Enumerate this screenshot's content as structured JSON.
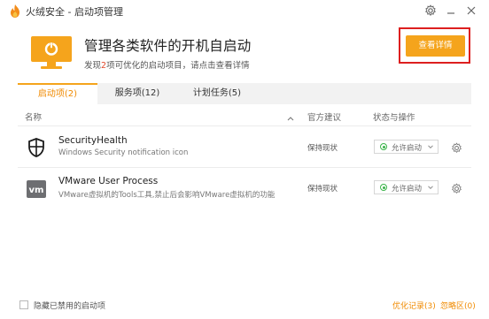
{
  "window": {
    "title": "火绒安全 - 启动项管理"
  },
  "header": {
    "heading": "管理各类软件的开机自启动",
    "subtitle_pre": "发现",
    "subtitle_count": "2",
    "subtitle_post": "项可优化的启动项目，请点击查看详情",
    "detail_button": "查看详情"
  },
  "tabs": [
    {
      "label": "启动项(2)",
      "active": true
    },
    {
      "label": "服务项(12)",
      "active": false
    },
    {
      "label": "计划任务(5)",
      "active": false
    }
  ],
  "table": {
    "col_name": "名称",
    "col_advice": "官方建议",
    "col_status": "状态与操作",
    "rows": [
      {
        "name": "SecurityHealth",
        "desc": "Windows Security notification icon",
        "advice": "保持现状",
        "status": "允许启动",
        "icon": "shield-icon"
      },
      {
        "name": "VMware User Process",
        "desc": "VMware虚拟机的Tools工具,禁止后会影响VMware虚拟机的功能",
        "advice": "保持现状",
        "status": "允许启动",
        "icon": "vmware-icon"
      }
    ]
  },
  "footer": {
    "hide_disabled": "隐藏已禁用的启动项",
    "optimize_log": "优化记录(3)",
    "ignore_zone": "忽略区(0)"
  },
  "colors": {
    "accent": "#f5a41c",
    "active_tab": "#f08a00",
    "highlight": "#dd1f1f",
    "status_ok": "#3bb44a"
  }
}
